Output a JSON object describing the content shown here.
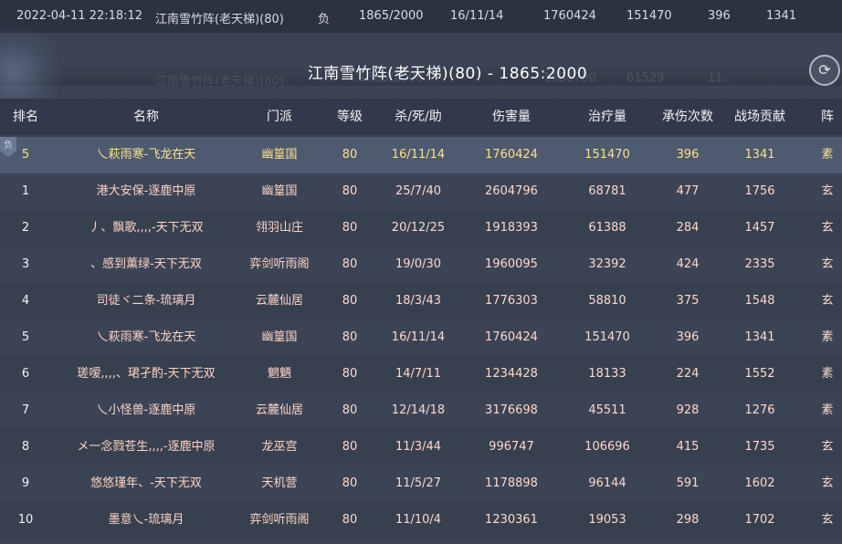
{
  "topbar": {
    "datetime": "2022-04-11 22:18:12",
    "map": "江南雪竹阵(老天梯)(80)",
    "result": "负",
    "score": "1865/2000",
    "kda": "16/11/14",
    "damage": "1760424",
    "healing": "151470",
    "hits": "396",
    "contribution": "1341"
  },
  "ghost": {
    "map": "江南雪竹阵(老天梯)(80)",
    "score": "1865/2000",
    "damage": "1680700",
    "healing": "61529",
    "contribution": "11"
  },
  "panel": {
    "title": "江南雪竹阵(老天梯)(80) - 1865:2000",
    "close_icon": "⟳"
  },
  "table": {
    "headers": [
      "排名",
      "名称",
      "门派",
      "等级",
      "杀/死/助",
      "伤害量",
      "治疗量",
      "承伤次数",
      "战场贡献",
      "阵"
    ],
    "self_flag": "负",
    "self_row": {
      "rank": "5",
      "name": "乀萩雨寒-飞龙在天",
      "sect": "幽篁国",
      "level": "80",
      "kda": "16/11/14",
      "damage": "1760424",
      "healing": "151470",
      "hits": "396",
      "contribution": "1341",
      "camp": "素"
    },
    "rows": [
      {
        "rank": "1",
        "name": "港大安保-逐鹿中原",
        "sect": "幽篁国",
        "level": "80",
        "kda": "25/7/40",
        "damage": "2604796",
        "healing": "68781",
        "hits": "477",
        "contribution": "1756",
        "camp": "玄"
      },
      {
        "rank": "2",
        "name": "丿、飘歌,,,,-天下无双",
        "sect": "翎羽山庄",
        "level": "80",
        "kda": "20/12/25",
        "damage": "1918393",
        "healing": "61388",
        "hits": "284",
        "contribution": "1457",
        "camp": "玄"
      },
      {
        "rank": "3",
        "name": "、感到薰绿-天下无双",
        "sect": "弈剑听雨阁",
        "level": "80",
        "kda": "19/0/30",
        "damage": "1960095",
        "healing": "32392",
        "hits": "424",
        "contribution": "2335",
        "camp": "玄"
      },
      {
        "rank": "4",
        "name": "司徒ヾ二条-琉璃月",
        "sect": "云麓仙居",
        "level": "80",
        "kda": "18/3/43",
        "damage": "1776303",
        "healing": "58810",
        "hits": "375",
        "contribution": "1548",
        "camp": "玄"
      },
      {
        "rank": "5",
        "name": "乀萩雨寒-飞龙在天",
        "sect": "幽篁国",
        "level": "80",
        "kda": "16/11/14",
        "damage": "1760424",
        "healing": "151470",
        "hits": "396",
        "contribution": "1341",
        "camp": "素"
      },
      {
        "rank": "6",
        "name": "瑳嗳,,,,、珺孑酌-天下无双",
        "sect": "魍魉",
        "level": "80",
        "kda": "14/7/11",
        "damage": "1234428",
        "healing": "18133",
        "hits": "224",
        "contribution": "1552",
        "camp": "素"
      },
      {
        "rank": "7",
        "name": "乀小怪兽-逐鹿中原",
        "sect": "云麓仙居",
        "level": "80",
        "kda": "12/14/18",
        "damage": "3176698",
        "healing": "45511",
        "hits": "928",
        "contribution": "1276",
        "camp": "素"
      },
      {
        "rank": "8",
        "name": "メ一念戮苍生,,,,-逐鹿中原",
        "sect": "龙巫宫",
        "level": "80",
        "kda": "11/3/44",
        "damage": "996747",
        "healing": "106696",
        "hits": "415",
        "contribution": "1735",
        "camp": "玄"
      },
      {
        "rank": "9",
        "name": "悠悠瑾年、-天下无双",
        "sect": "天机营",
        "level": "80",
        "kda": "11/5/27",
        "damage": "1178898",
        "healing": "96144",
        "hits": "591",
        "contribution": "1602",
        "camp": "玄"
      },
      {
        "rank": "10",
        "name": "墨意乀-琉璃月",
        "sect": "弈剑听雨阁",
        "level": "80",
        "kda": "11/10/4",
        "damage": "1230361",
        "healing": "19053",
        "hits": "298",
        "contribution": "1702",
        "camp": "玄"
      }
    ]
  }
}
